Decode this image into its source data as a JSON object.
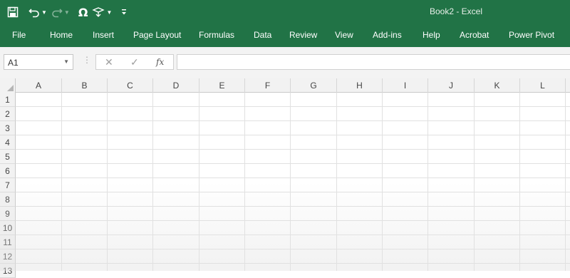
{
  "window": {
    "title": "Book2  -  Excel"
  },
  "qat": {
    "save_icon": "save-icon",
    "undo_icon": "undo-icon",
    "redo_icon": "redo-icon",
    "symbol_icon": "omega-symbol-icon",
    "touch_icon": "touch-mode-icon",
    "customize_icon": "customize-qat-icon",
    "symbol_glyph": "Ω"
  },
  "ribbon": {
    "tabs": [
      "File",
      "Home",
      "Insert",
      "Page Layout",
      "Formulas",
      "Data",
      "Review",
      "View",
      "Add-ins",
      "Help",
      "Acrobat",
      "Power Pivot"
    ]
  },
  "formula_bar": {
    "name_box": "A1",
    "dots": "⋮",
    "cancel": "✕",
    "enter": "✓",
    "fx": "fx",
    "value": ""
  },
  "grid": {
    "columns": [
      "A",
      "B",
      "C",
      "D",
      "E",
      "F",
      "G",
      "H",
      "I",
      "J",
      "K",
      "L"
    ],
    "rows": [
      "1",
      "2",
      "3",
      "4",
      "5",
      "6",
      "7",
      "8",
      "9",
      "10",
      "11",
      "12",
      "13"
    ]
  },
  "colors": {
    "excel_green": "#217346",
    "header_gray": "#f2f2f2",
    "grid_line": "#e1e1e1"
  }
}
